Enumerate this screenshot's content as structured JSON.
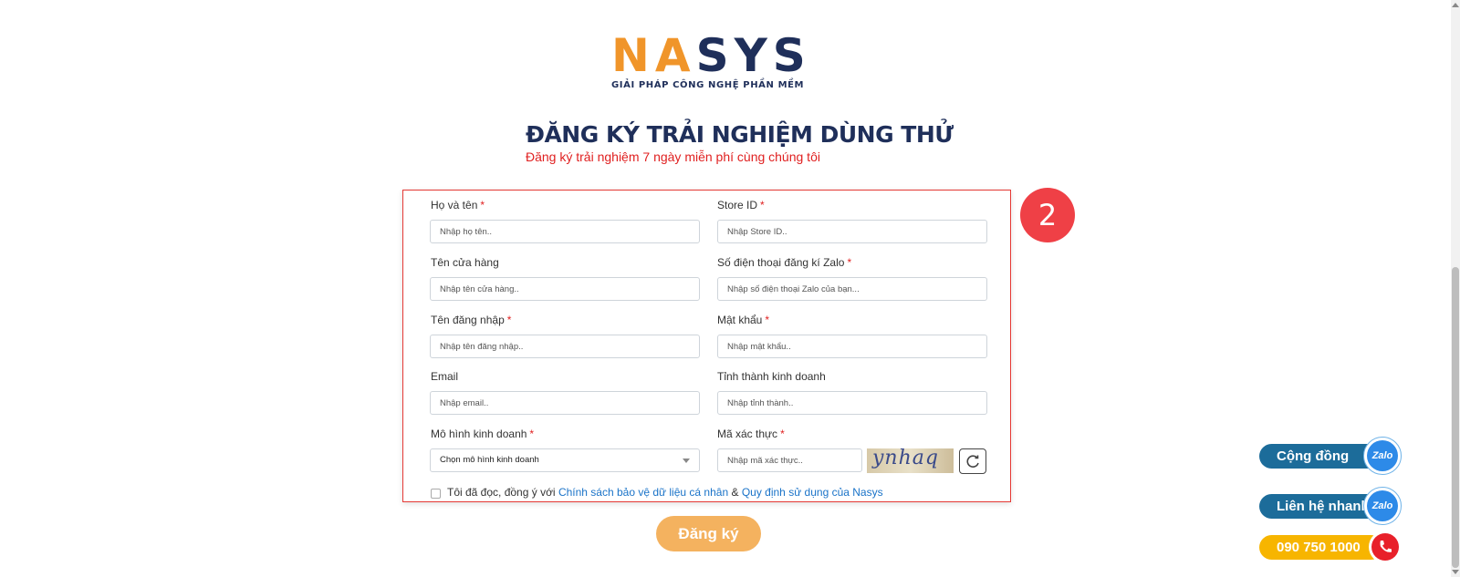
{
  "brand": {
    "logo_letters": [
      "N",
      "A",
      "S",
      "Y",
      "S"
    ],
    "tagline": "GIẢI PHÁP CÔNG NGHỆ PHẦN MỀM"
  },
  "header": {
    "title": "ĐĂNG KÝ TRẢI NGHIỆM DÙNG THỬ",
    "subtitle": "Đăng ký trải nghiệm 7 ngày miễn phí cùng chúng tôi"
  },
  "step_badge": "2",
  "form": {
    "full_name": {
      "label": "Họ và tên",
      "required_mark": "*",
      "placeholder": "Nhập họ tên.."
    },
    "store_id": {
      "label": "Store ID",
      "required_mark": "*",
      "placeholder": "Nhập Store ID.."
    },
    "store_name": {
      "label": "Tên cửa hàng",
      "placeholder": "Nhập tên cửa hàng.."
    },
    "zalo_phone": {
      "label": "Số điện thoại đăng kí Zalo",
      "required_mark": "*",
      "placeholder": "Nhập số điện thoại Zalo của bạn..."
    },
    "username": {
      "label": "Tên đăng nhập",
      "required_mark": "*",
      "placeholder": "Nhập tên đăng nhập.."
    },
    "password": {
      "label": "Mật khẩu",
      "required_mark": "*",
      "placeholder": "Nhập mật khẩu.."
    },
    "email": {
      "label": "Email",
      "placeholder": "Nhập email.."
    },
    "province": {
      "label": "Tỉnh thành kinh doanh",
      "placeholder": "Nhập tỉnh thành.."
    },
    "business_model": {
      "label": "Mô hình kinh doanh",
      "required_mark": "*",
      "selected": "Chọn mô hình kinh doanh"
    },
    "captcha": {
      "label": "Mã xác thực",
      "required_mark": "*",
      "placeholder": "Nhập mã xác thực..",
      "image_text": "ynhaq"
    },
    "agreement": {
      "prefix": "Tôi đã đọc, đồng ý với",
      "privacy_link": "Chính sách bảo vệ dữ liệu cá nhân",
      "joiner": "&",
      "terms_link": "Quy định sử dụng của Nasys"
    },
    "submit_label": "Đăng ký"
  },
  "floating": {
    "community": {
      "label": "Cộng đồng",
      "icon_text": "Zalo"
    },
    "quick_contact": {
      "label": "Liên hệ nhanh",
      "icon_text": "Zalo"
    },
    "hotline": {
      "label": "090 750 1000"
    }
  },
  "colors": {
    "brand_orange": "#f0952a",
    "brand_navy": "#1f2f5a",
    "accent_red": "#e02020",
    "link_blue": "#1a73c8",
    "submit_orange": "#f4b25f",
    "float_blue": "#1c6c9a",
    "hotline_yellow": "#f7b500"
  }
}
